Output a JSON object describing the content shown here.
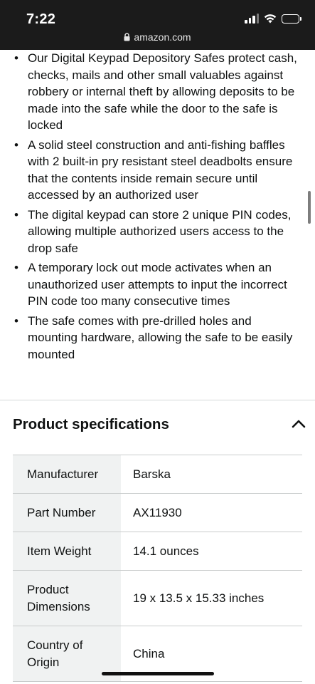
{
  "status_bar": {
    "time": "7:22",
    "url": "amazon.com",
    "icons": [
      "signal-icon",
      "wifi-icon",
      "battery-icon",
      "lock-icon"
    ]
  },
  "features": [
    "Our Digital Keypad Depository Safes protect cash, checks, mails and other small valuables against robbery or internal theft by allowing deposits to be made into the safe while the door to the safe is locked",
    "A solid steel construction and anti-fishing baffles with 2 built-in pry resistant steel deadbolts ensure that the contents inside remain secure until accessed by an authorized user",
    "The digital keypad can store 2 unique PIN codes, allowing multiple authorized users access to the drop safe",
    "A temporary lock out mode activates when an unauthorized user attempts to input the incorrect PIN code too many consecutive times",
    "The safe comes with pre-drilled holes and mounting hardware, allowing the safe to be easily mounted"
  ],
  "specs": {
    "title": "Product specifications",
    "rows": [
      {
        "label": "Manufacturer",
        "value": "Barska"
      },
      {
        "label": "Part Number",
        "value": "AX11930"
      },
      {
        "label": "Item Weight",
        "value": "14.1 ounces"
      },
      {
        "label": "Product Dimensions",
        "value": "19 x 13.5 x 15.33 inches"
      },
      {
        "label": "Country of Origin",
        "value": "China"
      }
    ]
  },
  "colors": {
    "status_bar_bg": "#1b1b1b",
    "text": "#0f1111",
    "label_cell_bg": "#f0f2f2",
    "border": "#c9cccc"
  }
}
